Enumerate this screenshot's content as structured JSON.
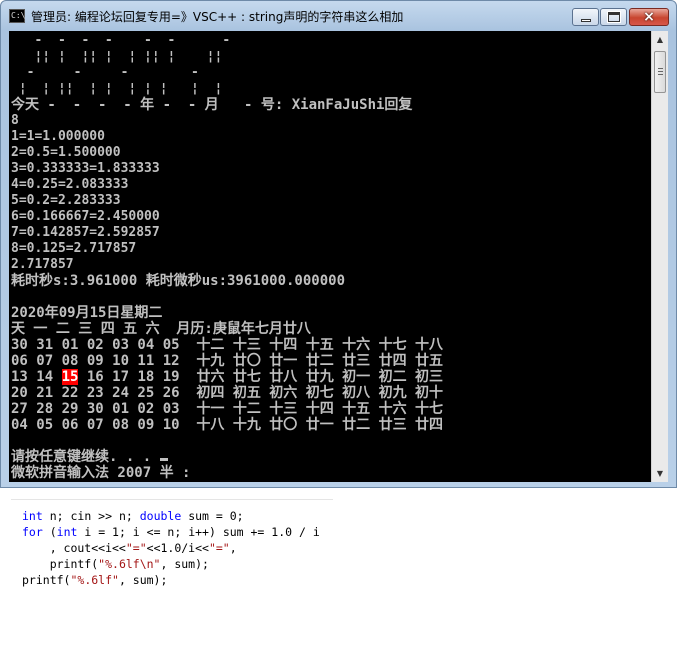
{
  "window": {
    "title": "管理员:  编程论坛回复专用=》VSC++ :  string声明的字符串这么相加",
    "icon_name": "console-app-icon",
    "buttons": {
      "minimize": "minimize-icon",
      "maximize": "maximize-icon",
      "close": "×"
    }
  },
  "console": {
    "art_lines": [
      "   -  -  -  -    -  -      -",
      "   ¦¦ ¦  ¦¦ ¦  ¦ ¦¦ ¦    ¦¦",
      "  -     -     -        -",
      " ¦  ¦ ¦¦  ¦ ¦  ¦ ¦ ¦   ¦  ¦"
    ],
    "header_line": "今天 -  -  -  - 年 -  - 月   - 号: XianFaJuShi回复",
    "output_lines": [
      "8",
      "1=1=1.000000",
      "2=0.5=1.500000",
      "3=0.333333=1.833333",
      "4=0.25=2.083333",
      "5=0.2=2.283333",
      "6=0.166667=2.450000",
      "7=0.142857=2.592857",
      "8=0.125=2.717857",
      "2.717857"
    ],
    "timing_line": "耗时秒s:3.961000 耗时微秒us:3961000.000000",
    "date_line": "2020年09月15日星期二",
    "calendar_header": "天 一 二 三 四 五 六  月历:庚鼠年七月廿八",
    "calendar_rows": [
      "30 31 01 02 03 04 05  十二 十三 十四 十五 十六 十七 十八",
      "06 07 08 09 10 11 12  十九 廿〇 廿一 廿二 廿三 廿四 廿五",
      "13 14 15 16 17 18 19  廿六 廿七 廿八 廿九 初一 初二 初三",
      "20 21 22 23 24 25 26  初四 初五 初六 初七 初八 初九 初十",
      "27 28 29 30 01 02 03  十一 十二 十三 十四 十五 十六 十七",
      "04 05 06 07 08 09 10  十八 十九 廿〇 廿一 廿二 廿三 廿四"
    ],
    "highlight": {
      "before": "13 14 ",
      "day": "15",
      "after": " 16 17 18 19  廿六 廿七 廿八 廿九 初一 初二 初三",
      "color": "#ff0000"
    },
    "prompt_line": "请按任意键继续. . . ",
    "ime_line": "微软拼音输入法 2007 半 :"
  },
  "code": {
    "line1": {
      "k1": "int",
      "t1": " n; cin >> n; ",
      "k2": "double",
      "t2": " sum = 0;"
    },
    "line2": {
      "k1": "for",
      "t1": " (",
      "k2": "int",
      "t2": " i = 1; i <= n; i++) sum += 1.0 / i"
    },
    "line3": {
      "t1": "    , cout<<i<<",
      "s1": "\"=\"",
      "t2": "<<1.0/i<<",
      "s2": "\"=\"",
      "t3": ","
    },
    "line4": {
      "t1": "    printf(",
      "s1": "\"%.6lf\\n\"",
      "t2": ", sum);"
    },
    "line5": {
      "t1": "printf(",
      "s1": "\"%.6lf\"",
      "t2": ", sum);"
    }
  },
  "colors": {
    "console_bg": "#000000",
    "console_text": "#c0c0c0",
    "keyword": "#0000ff",
    "string": "#a31515"
  }
}
